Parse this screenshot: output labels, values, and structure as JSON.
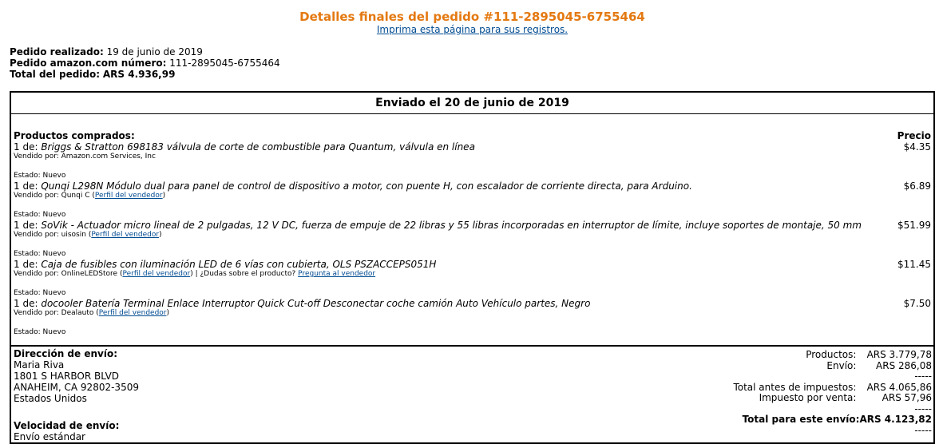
{
  "header": {
    "title": "Detalles finales del pedido #111-2895045-6755464",
    "print_link": "Imprima esta página para sus registros."
  },
  "order": {
    "date_label": "Pedido realizado:",
    "date_value": "19 de junio de 2019",
    "number_label": "Pedido amazon.com número:",
    "number_value": "111-2895045-6755464",
    "total_label": "Total del pedido:",
    "total_value": "ARS 4.936,99"
  },
  "shipment": {
    "heading": "Enviado el 20 de junio de 2019",
    "products_label": "Productos comprados:",
    "price_label": "Precio",
    "items": [
      {
        "qty": "1 de:",
        "name": "Briggs & Stratton 698183 válvula de corte de combustible para Quantum, válvula en línea",
        "price": "$4.35",
        "seller": "Vendido por: Amazon.com Services, Inc",
        "status": "Estado: Nuevo"
      },
      {
        "qty": "1 de:",
        "name": "Qunqi L298N Módulo dual para panel de control de dispositivo a motor, con puente H, con escalador de corriente directa, para Arduino.",
        "price": "$6.89",
        "seller": "Vendido por: Qunqi C",
        "seller_link": "Perfil del vendedor",
        "status": "Estado: Nuevo"
      },
      {
        "qty": "1 de:",
        "name": "SoVik - Actuador micro lineal de 2 pulgadas, 12 V DC, fuerza de empuje de 22 libras y 55 libras incorporadas en interruptor de límite, incluye soportes de montaje, 50 mm",
        "price": "$51.99",
        "seller": "Vendido por: uisosin",
        "seller_link": "Perfil del vendedor",
        "status": "Estado: Nuevo"
      },
      {
        "qty": "1 de:",
        "name": "Caja de fusibles con iluminación LED de 6 vías con cubierta, OLS PSZACCEPS051H",
        "price": "$11.45",
        "seller": "Vendido por: OnlineLEDStore",
        "seller_link": "Perfil del vendedor",
        "question": "| ¿Dudas sobre el producto?",
        "question_link": "Pregunta al vendedor",
        "status": "Estado: Nuevo"
      },
      {
        "qty": "1 de:",
        "name": "docooler Batería Terminal Enlace Interruptor Quick Cut-off Desconectar coche camión Auto Vehículo partes, Negro",
        "price": "$7.50",
        "seller": "Vendido por: Dealauto",
        "seller_link": "Perfil del vendedor",
        "status": "Estado: Nuevo"
      }
    ]
  },
  "shipping": {
    "address_label": "Dirección de envío:",
    "name": "Maria Riva",
    "street": "1801 S HARBOR BLVD",
    "city": "ANAHEIM, CA 92802-3509",
    "country": "Estados Unidos",
    "speed_label": "Velocidad de envío:",
    "speed_value": "Envío estándar"
  },
  "totals": {
    "products_label": "Productos:",
    "products_value": "ARS 3.779,78",
    "shipping_label": "Envío:",
    "shipping_value": "ARS 286,08",
    "dash": "-----",
    "pretax_label": "Total antes de impuestos:",
    "pretax_value": "ARS 4.065,86",
    "tax_label": "Impuesto por venta:",
    "tax_value": "ARS 57,96",
    "shipment_total_label": "Total para este envío:",
    "shipment_total_value": "ARS 4.123,82"
  }
}
